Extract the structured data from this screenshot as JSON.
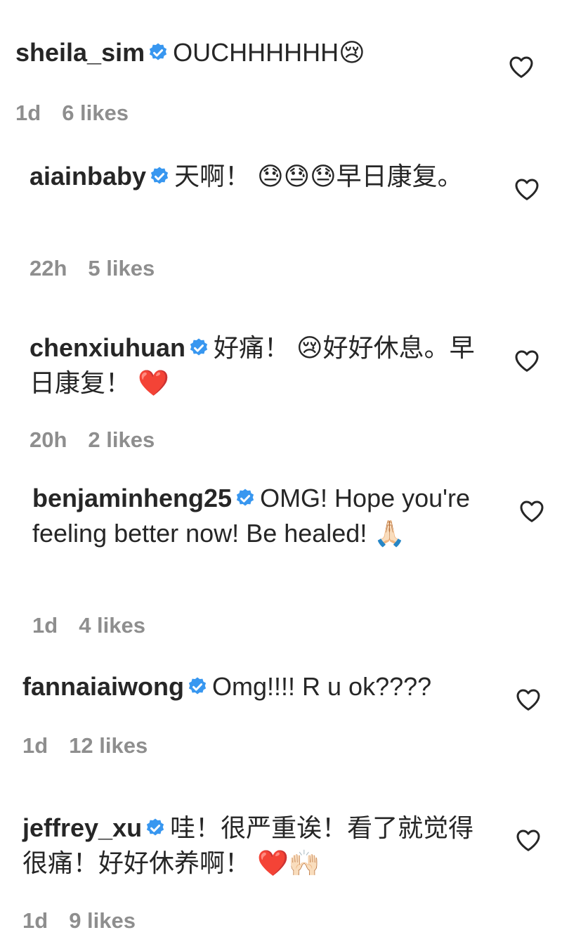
{
  "colors": {
    "text": "#262626",
    "meta": "#8e8e8e",
    "verified_badge": "#3897f0",
    "heart_outline": "#262626"
  },
  "icons": {
    "verified": "verified-badge-icon",
    "like": "heart-outline-icon"
  },
  "comments": [
    {
      "username": "sheila_sim",
      "verified": true,
      "text": "OUCHHHHHH😢",
      "age": "1d",
      "likes": "6 likes"
    },
    {
      "username": "aiainbaby",
      "verified": true,
      "text": "天啊！ 😓😓😓早日康复。",
      "age": "22h",
      "likes": "5 likes"
    },
    {
      "username": "chenxiuhuan",
      "verified": true,
      "text": "好痛！ 😢好好休息。早日康复！ ❤️",
      "age": "20h",
      "likes": "2 likes"
    },
    {
      "username": "benjaminheng25",
      "verified": true,
      "text": "OMG! Hope you're feeling better now! Be healed! 🙏🏻",
      "age": "1d",
      "likes": "4 likes"
    },
    {
      "username": "fannaiaiwong",
      "verified": true,
      "text": "Omg!!!! R u ok????",
      "age": "1d",
      "likes": "12 likes"
    },
    {
      "username": "jeffrey_xu",
      "verified": true,
      "text": "哇！很严重诶！看了就觉得很痛！好好休养啊！ ❤️🙌🏻",
      "age": "1d",
      "likes": "9 likes"
    }
  ]
}
